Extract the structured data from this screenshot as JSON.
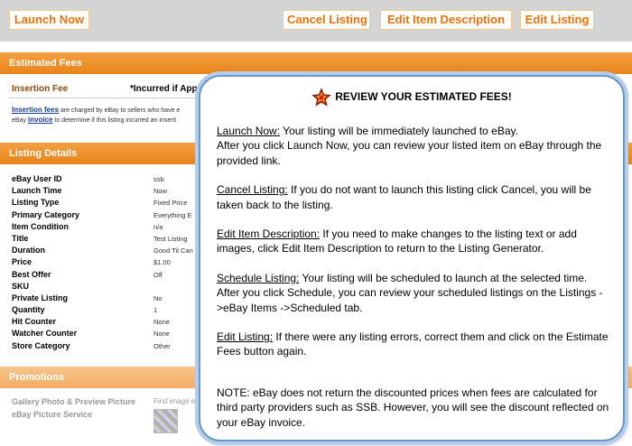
{
  "toolbar": {
    "launch_now": "Launch Now",
    "cancel_listing": "Cancel Listing",
    "edit_item_description": "Edit Item Description",
    "edit_listing": "Edit Listing"
  },
  "fees": {
    "header": "Estimated Fees",
    "insertion_fee_label": "Insertion Fee",
    "incurred_note": "*Incurred if App",
    "desc_link": "Insertion fees",
    "desc_text_1": " are charged by eBay to sellers who have e",
    "desc_text_2": "eBay ",
    "desc_link_2": "invoice",
    "desc_text_3": " to determine if this listing incurred an inserti"
  },
  "details": {
    "header": "Listing Details",
    "rows": [
      {
        "label": "eBay User ID",
        "value": "ssb"
      },
      {
        "label": "Launch Time",
        "value": "Now"
      },
      {
        "label": "Listing Type",
        "value": "Fixed Price"
      },
      {
        "label": "Primary Category",
        "value": "Everything E"
      },
      {
        "label": "Item Condition",
        "value": "n/a"
      },
      {
        "label": "Title",
        "value": "Test Listing"
      },
      {
        "label": "Duration",
        "value": "Good Til Can"
      },
      {
        "label": "Price",
        "value": "$1.00"
      },
      {
        "label": "Best Offer",
        "value": "Off"
      },
      {
        "label": "SKU",
        "value": ""
      },
      {
        "label": "Private Listing",
        "value": "No"
      },
      {
        "label": "Quantity",
        "value": "1"
      },
      {
        "label": "Hit Counter",
        "value": "None"
      },
      {
        "label": "Watcher Counter",
        "value": "None"
      },
      {
        "label": "Store Category",
        "value": "Other"
      }
    ]
  },
  "promotions": {
    "header": "Promotions",
    "gallery_label": "Gallery Photo & Preview Picture",
    "gallery_value": "First image e",
    "picture_service_label": "eBay Picture Service"
  },
  "modal": {
    "title": "REVIEW YOUR ESTIMATED FEES!",
    "icon": "red-star-icon",
    "launch_title": "Launch Now:",
    "launch_text": " Your listing will be immediately launched to eBay.",
    "launch_text_2": "After you click Launch Now, you can review your listed item on eBay through the provided link.",
    "cancel_title": "Cancel Listing:",
    "cancel_text": " If you do not want to launch this listing click Cancel, you will be taken back to the listing.",
    "edit_desc_title": "Edit Item Description:",
    "edit_desc_text": " If you need to make changes to the listing text or add images, click Edit Item Description to return to the Listing Generator.",
    "schedule_title": "Schedule Listing:",
    "schedule_text": " Your listing will be scheduled to launch at the selected time.  After you click Schedule, you can review your scheduled listings on the Listings ->eBay Items ->Scheduled tab.",
    "edit_listing_title": "Edit Listing:",
    "edit_listing_text": " If there were any listing errors, correct them and click on the Estimate Fees button again.",
    "note": "NOTE: eBay does not return the discounted prices when fees are calculated for third party providers such as SSB. However, you will see the discount reflected on your eBay invoice."
  },
  "colors": {
    "accent_orange": "#e8841c",
    "button_text": "#e8720c",
    "toolbar_bg": "#d4d4d4",
    "modal_border": "#6b96c8"
  }
}
